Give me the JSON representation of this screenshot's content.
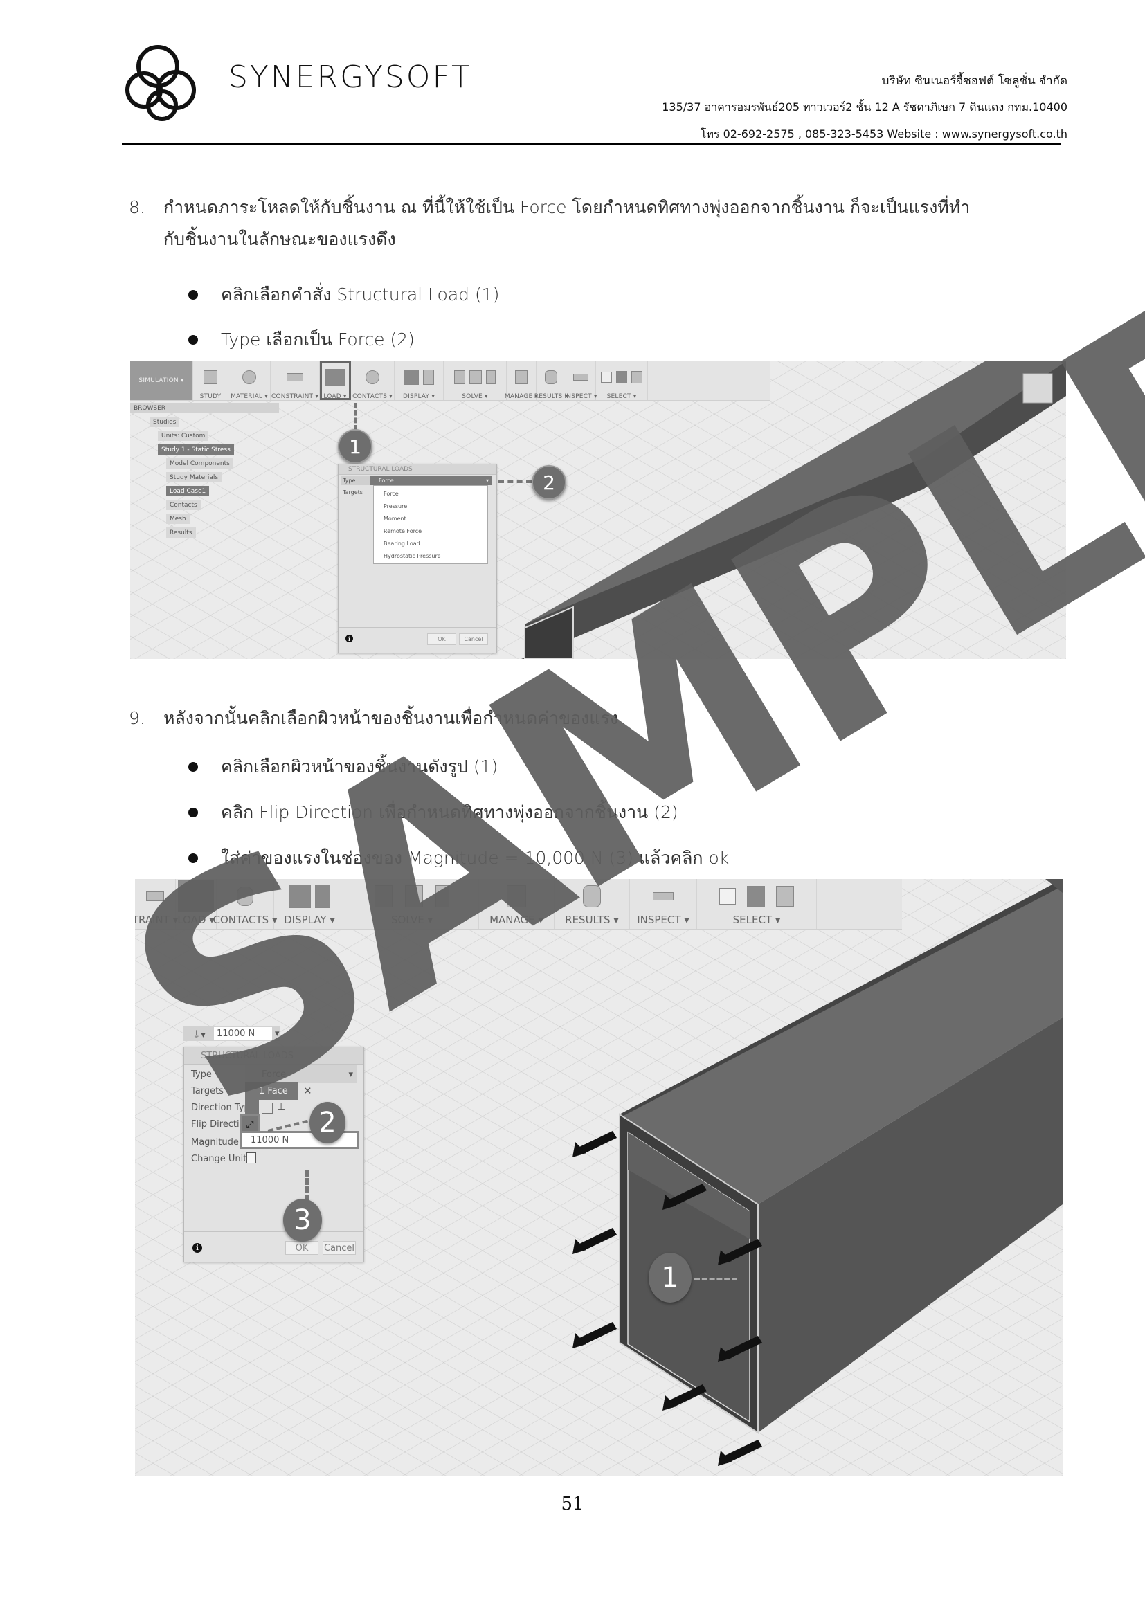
{
  "header": {
    "brand": "SYNERGYSOFT",
    "company": "บริษัท ซินเนอร์จี้ซอฟต์ โซลูชั่น จำกัด",
    "address": "135/37 อาคารอมรพันธ์205 ทาวเวอร์2 ชั้น 12 A รัชดาภิเษก 7 ดินแดง กทม.10400",
    "contact": "โทร 02-692-2575 , 085-323-5453 Website : www.synergysoft.co.th"
  },
  "step8": {
    "number": "8.",
    "text": "กำหนดภาระโหลดให้กับชิ้นงาน ณ ที่นี้ให้ใช้เป็น Force โดยกำหนดทิศทางพุ่งออกจากชิ้นงาน ก็จะเป็นแรงที่ทำ",
    "text_cont": "กับชิ้นงานในลักษณะของแรงดึง",
    "bullets": [
      "คลิกเลือกคำสั่ง Structural Load (1)",
      "Type เลือกเป็น Force (2)"
    ]
  },
  "shot1": {
    "toolbar": {
      "workspace": "SIMULATION ▾",
      "groups": [
        "STUDY",
        "MATERIAL ▾",
        "CONSTRAINT ▾",
        "LOAD ▾",
        "CONTACTS ▾",
        "DISPLAY ▾",
        "SOLVE ▾",
        "MANAGE ▾",
        "RESULTS ▾",
        "INSPECT ▾",
        "SELECT ▾"
      ]
    },
    "browser": {
      "title": "BROWSER",
      "items": [
        "Studies",
        "Units: Custom",
        "Study 1 - Static Stress",
        "Model Components",
        "Study Materials",
        "Load Case1",
        "Contacts",
        "Mesh",
        "Results"
      ]
    },
    "dialog": {
      "title": "STRUCTURAL LOADS",
      "type_label": "Type",
      "type_value": "Force",
      "targets_label": "Targets",
      "options": [
        "Force",
        "Pressure",
        "Moment",
        "Remote Force",
        "Bearing Load",
        "Hydrostatic Pressure"
      ],
      "ok": "OK",
      "cancel": "Cancel"
    },
    "callouts": [
      "1",
      "2"
    ]
  },
  "step9": {
    "number": "9.",
    "text": "หลังจากนั้นคลิกเลือกผิวหน้าของชิ้นงานเพื่อกำหนดค่าของแรง",
    "bullets": [
      "คลิกเลือกผิวหน้าของชิ้นงานดังรูป (1)",
      "คลิก Flip Direction เพื่อกำหนดทิศทางพุ่งออกจากชิ้นงาน (2)",
      "ใส่ค่าของแรงในช่องของ Magnitude = 10,000 N (3) แล้วคลิก ok"
    ]
  },
  "shot2": {
    "toolbar": {
      "groups": [
        "TRAINT ▾",
        "LOAD ▾",
        "CONTACTS ▾",
        "DISPLAY ▾",
        "SOLVE ▾",
        "MANAGE ▾",
        "RESULTS ▾",
        "INSPECT ▾",
        "SELECT ▾"
      ]
    },
    "mini_input": "11000 N",
    "dialog": {
      "title": "STRUCTURAL LOADS",
      "rows": {
        "type_label": "Type",
        "type_value": "Force",
        "targets_label": "Targets",
        "targets_value": "1 Face",
        "direction_label": "Direction Type",
        "flip_label": "Flip Direction",
        "magnitude_label": "Magnitude",
        "magnitude_value": "11000 N",
        "units_label": "Change Units"
      },
      "ok": "OK",
      "cancel": "Cancel"
    },
    "callouts": [
      "1",
      "2",
      "3"
    ]
  },
  "watermark": "SAMPLE",
  "page_number": "51"
}
